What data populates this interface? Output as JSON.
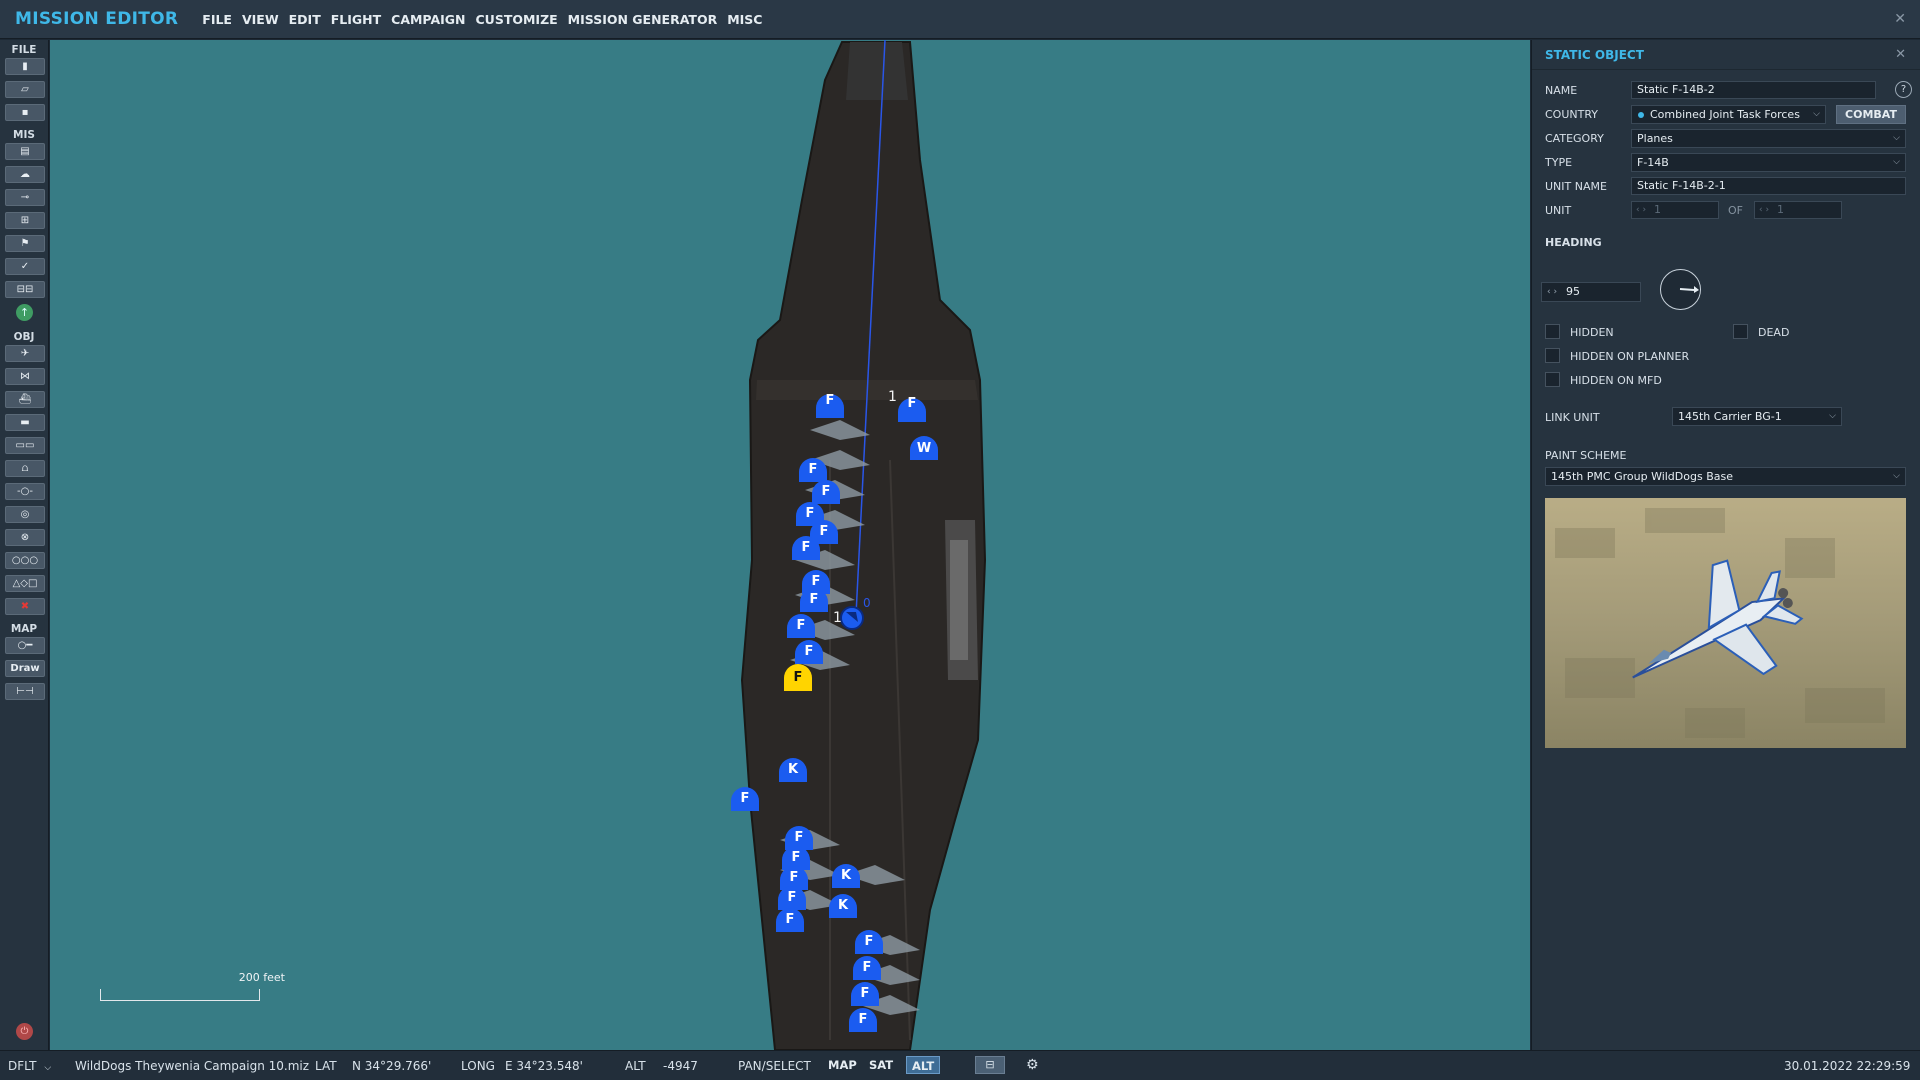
{
  "app": {
    "title": "MISSION EDITOR",
    "menu": [
      "FILE",
      "VIEW",
      "EDIT",
      "FLIGHT",
      "CAMPAIGN",
      "CUSTOMIZE",
      "MISSION GENERATOR",
      "MISC"
    ]
  },
  "toolbar": {
    "sections": {
      "file": "FILE",
      "mis": "MIS",
      "obj": "OBJ",
      "map": "MAP"
    },
    "draw_label": "Draw"
  },
  "map": {
    "scale_label": "200 feet",
    "units": [
      {
        "letter": "F",
        "color": "#1b5cf0"
      },
      {
        "letter": "W",
        "color": "#1b5cf0"
      },
      {
        "letter": "K",
        "color": "#1b5cf0"
      },
      {
        "letter": "F",
        "color": "#ffd400",
        "selected": true
      }
    ],
    "labels": [
      "1",
      "1",
      "0"
    ]
  },
  "panel": {
    "title": "STATIC OBJECT",
    "name_label": "NAME",
    "name_value": "Static F-14B-2",
    "country_label": "COUNTRY",
    "country_value": "Combined Joint Task Forces",
    "combat_button": "COMBAT",
    "category_label": "CATEGORY",
    "category_value": "Planes",
    "type_label": "TYPE",
    "type_value": "F-14B",
    "unit_name_label": "UNIT NAME",
    "unit_name_value": "Static F-14B-2-1",
    "unit_label": "UNIT",
    "unit_value": "1",
    "of_label": "OF",
    "of_value": "1",
    "heading_label": "HEADING",
    "heading_value": "95",
    "hidden_label": "HIDDEN",
    "dead_label": "DEAD",
    "hidden_planner_label": "HIDDEN ON PLANNER",
    "hidden_mfd_label": "HIDDEN ON MFD",
    "link_unit_label": "LINK UNIT",
    "link_unit_value": "145th Carrier BG-1",
    "paint_scheme_label": "PAINT SCHEME",
    "paint_scheme_value": "145th PMC Group WildDogs Base",
    "help_glyph": "?",
    "close_glyph": "✕"
  },
  "status": {
    "profile": "DFLT",
    "file": "WildDogs Theywenia Campaign 10.miz",
    "lat_label": "LAT",
    "lat_value": "N 34°29.766'",
    "long_label": "LONG",
    "long_value": "E 34°23.548'",
    "alt_label": "ALT",
    "alt_value": "-4947",
    "mode": "PAN/SELECT",
    "map_btn": "MAP",
    "sat_btn": "SAT",
    "alt_btn": "ALT",
    "datetime": "30.01.2022 22:29:59"
  },
  "colors": {
    "accent": "#3fb8e8",
    "sea": "#377c85",
    "blue_unit": "#1b5cf0",
    "selected_unit": "#ffd400"
  }
}
